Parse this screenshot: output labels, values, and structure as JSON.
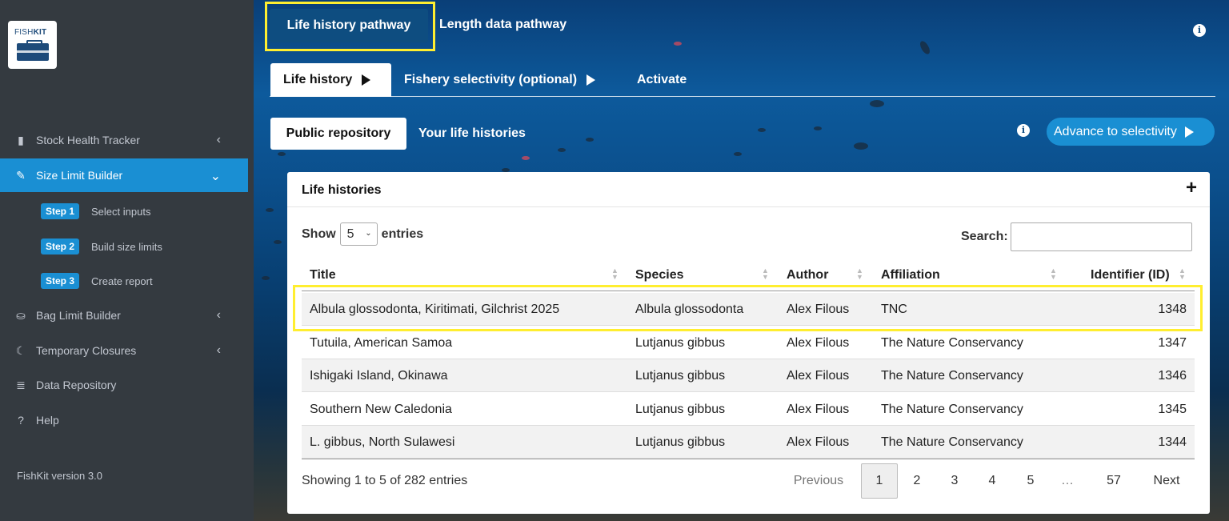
{
  "sidebar": {
    "logo_text_light": "FISH",
    "logo_text_bold": "KIT",
    "items": [
      {
        "label": "Stock Health Tracker",
        "icon": "bar-chart-icon"
      },
      {
        "label": "Size Limit Builder",
        "icon": "ruler-icon"
      },
      {
        "label": "Bag Limit Builder",
        "icon": "basket-icon"
      },
      {
        "label": "Temporary Closures",
        "icon": "moon-icon"
      },
      {
        "label": "Data Repository",
        "icon": "database-icon"
      },
      {
        "label": "Help",
        "icon": "question-icon"
      }
    ],
    "steps": [
      {
        "badge": "Step 1",
        "label": "Select inputs"
      },
      {
        "badge": "Step 2",
        "label": "Build size limits"
      },
      {
        "badge": "Step 3",
        "label": "Create report"
      }
    ],
    "version": "FishKit version 3.0"
  },
  "pathway": {
    "active": "Life history pathway",
    "other": "Length data pathway"
  },
  "subtabs": {
    "life_history": "Life history",
    "selectivity": "Fishery selectivity (optional)",
    "activate": "Activate"
  },
  "repo": {
    "public": "Public repository",
    "yours": "Your life histories",
    "advance": "Advance to selectivity"
  },
  "card": {
    "title": "Life histories",
    "show_label": "Show",
    "show_value": "5",
    "entries_label": "entries",
    "search_label": "Search:",
    "search_value": "",
    "columns": [
      "Title",
      "Species",
      "Author",
      "Affiliation",
      "Identifier (ID)"
    ],
    "rows": [
      {
        "title": "Albula glossodonta, Kiritimati, Gilchrist 2025",
        "species": "Albula glossodonta",
        "author": "Alex Filous",
        "affiliation": "TNC",
        "id": "1348"
      },
      {
        "title": "Tutuila, American Samoa",
        "species": "Lutjanus gibbus",
        "author": "Alex Filous",
        "affiliation": "The Nature Conservancy",
        "id": "1347"
      },
      {
        "title": "Ishigaki Island, Okinawa",
        "species": "Lutjanus gibbus",
        "author": "Alex Filous",
        "affiliation": "The Nature Conservancy",
        "id": "1346"
      },
      {
        "title": "Southern New Caledonia",
        "species": "Lutjanus gibbus",
        "author": "Alex Filous",
        "affiliation": "The Nature Conservancy",
        "id": "1345"
      },
      {
        "title": "L. gibbus, North Sulawesi",
        "species": "Lutjanus gibbus",
        "author": "Alex Filous",
        "affiliation": "The Nature Conservancy",
        "id": "1344"
      }
    ],
    "info": "Showing 1 to 5 of 282 entries",
    "pager": {
      "previous": "Previous",
      "pages": [
        "1",
        "2",
        "3",
        "4",
        "5"
      ],
      "ellipsis": "…",
      "last": "57",
      "next": "Next"
    }
  },
  "colors": {
    "accent": "#1a8fd3",
    "sidebar": "#343a40",
    "highlight": "#ffee30"
  }
}
